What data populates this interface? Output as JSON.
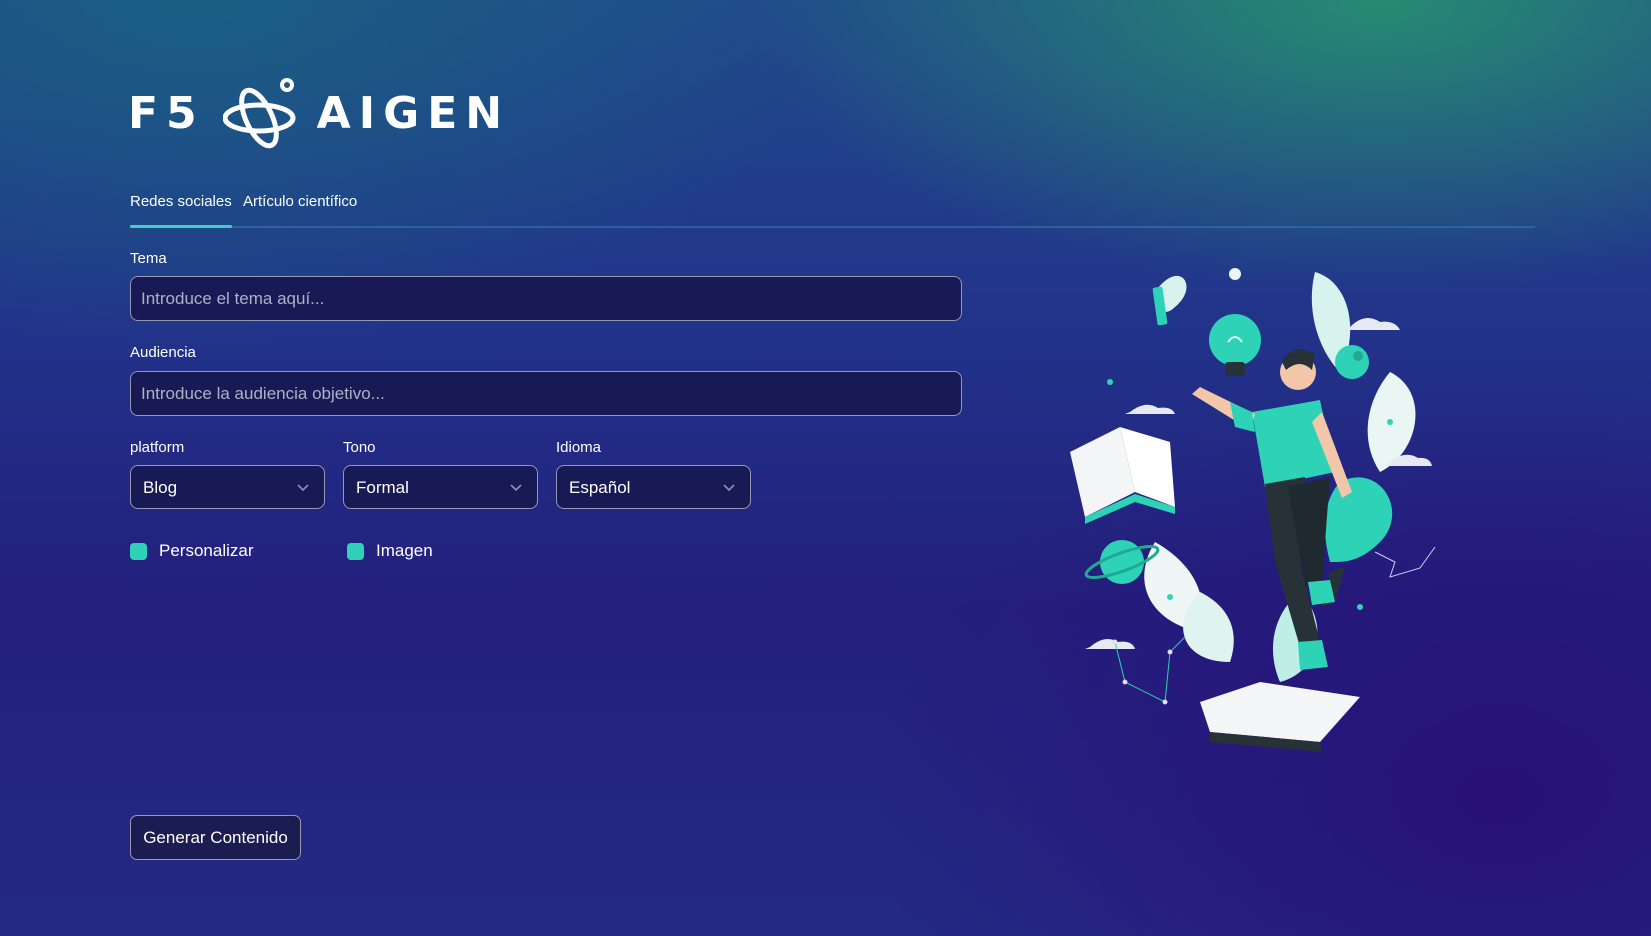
{
  "brand": {
    "left_text": "F5",
    "right_text": "AIGEN",
    "logo_icon": "atom-orbit-icon"
  },
  "tabs": [
    {
      "label": "Redes sociales",
      "active": true
    },
    {
      "label": "Artículo científico",
      "active": false
    }
  ],
  "form": {
    "tema": {
      "label": "Tema",
      "placeholder": "Introduce el tema aquí...",
      "value": ""
    },
    "audiencia": {
      "label": "Audiencia",
      "placeholder": "Introduce la audiencia objetivo...",
      "value": ""
    },
    "platform": {
      "label": "platform",
      "value": "Blog"
    },
    "tono": {
      "label": "Tono",
      "value": "Formal"
    },
    "idioma": {
      "label": "Idioma",
      "value": "Español"
    },
    "personalizar": {
      "label": "Personalizar",
      "checked": true
    },
    "imagen": {
      "label": "Imagen",
      "checked": true
    },
    "submit_label": "Generar Contenido"
  },
  "colors": {
    "accent": "#3fd0c4",
    "checkbox": "#2ed3b7",
    "input_bg": "#181a55"
  },
  "illustration": {
    "icon": "person-floating-ideas-illustration"
  }
}
